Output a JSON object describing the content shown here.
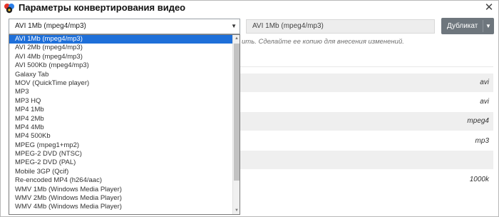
{
  "window": {
    "title": "Параметры конвертирования видео",
    "close_glyph": "✕"
  },
  "preset_select": {
    "value": "AVI 1Mb (mpeg4/mp3)",
    "arrow_glyph": "▼"
  },
  "name_input": {
    "value": "AVI 1Mb (mpeg4/mp3)"
  },
  "duplicate_button": {
    "label": "Дубликат",
    "arrow_glyph": "▼"
  },
  "hint": "ить. Сделайте ее копию для внесения изменений.",
  "rows": [
    {
      "value": "avi"
    },
    {
      "value": "avi"
    },
    {
      "value": "mpeg4"
    },
    {
      "value": "mp3"
    },
    {
      "value": ""
    },
    {
      "value": "1000k"
    }
  ],
  "dropdown": {
    "options": [
      "AVI 1Mb (mpeg4/mp3)",
      "AVI 2Mb (mpeg4/mp3)",
      "AVI 4Mb (mpeg4/mp3)",
      "AVI 500Kb (mpeg4/mp3)",
      "Galaxy Tab",
      "MOV (QuickTime player)",
      "MP3",
      "MP3 HQ",
      "MP4 1Mb",
      "MP4 2Mb",
      "MP4 4Mb",
      "MP4 500Kb",
      "MPEG (mpeg1+mp2)",
      "MPEG-2 DVD (NTSC)",
      "MPEG-2 DVD (PAL)",
      "Mobile 3GP (Qcif)",
      "Re-encoded MP4 (h264/aac)",
      "WMV 1Mb (Windows Media Player)",
      "WMV 2Mb (Windows Media Player)",
      "WMV 4Mb (Windows Media Player)"
    ],
    "selected_index": 0
  },
  "colors": {
    "selection": "#1e6fd9",
    "button": "#6e767d"
  }
}
